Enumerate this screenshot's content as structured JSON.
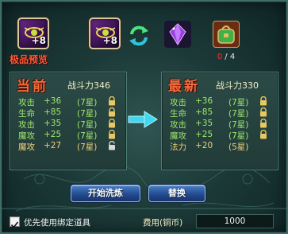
{
  "top": {
    "premium_preview_label": "极品预览",
    "preview_slot_plus": "+8",
    "current_slot_plus": "+8",
    "bag_count_current": "0",
    "bag_count_separator": " / ",
    "bag_count_total": "4"
  },
  "current": {
    "title": "当前",
    "power_label": "战斗力",
    "power_value": "346",
    "rows": [
      {
        "attr": "攻击",
        "value": "+36",
        "star": "(7星)",
        "locked": true
      },
      {
        "attr": "生命",
        "value": "+85",
        "star": "(7星)",
        "locked": true
      },
      {
        "attr": "攻击",
        "value": "+35",
        "star": "(7星)",
        "locked": true
      },
      {
        "attr": "魔攻",
        "value": "+25",
        "star": "(7星)",
        "locked": true
      },
      {
        "attr": "魔攻",
        "value": "+27",
        "star": "(7星)",
        "locked": false
      }
    ]
  },
  "latest": {
    "title": "最新",
    "power_label": "战斗力",
    "power_value": "330",
    "rows": [
      {
        "attr": "攻击",
        "value": "+36",
        "star": "(7星)",
        "locked": true
      },
      {
        "attr": "生命",
        "value": "+85",
        "star": "(7星)",
        "locked": true
      },
      {
        "attr": "攻击",
        "value": "+35",
        "star": "(7星)",
        "locked": true
      },
      {
        "attr": "魔攻",
        "value": "+25",
        "star": "(7星)",
        "locked": true
      },
      {
        "attr": "法力",
        "value": "+20",
        "star": "(5星)",
        "locked": false
      }
    ]
  },
  "actions": {
    "start_refine_label": "开始洗炼",
    "replace_label": "替换"
  },
  "footer": {
    "prefer_bound_label": "优先使用绑定道具",
    "prefer_bound_checked": true,
    "cost_label": "费用(铜币)",
    "cost_value": "1000"
  },
  "icons": {
    "preview_slot": "enhanced-item-icon",
    "current_slot": "enhanced-item-icon",
    "refresh": "refresh-cycle-icon",
    "crystal": "purple-crystal-icon",
    "bag": "green-bag-icon",
    "arrow": "right-arrow-icon",
    "lock": "lock-icon",
    "checkbox": "check-icon"
  },
  "colors": {
    "title_orange": "#f26a3e",
    "attr_green": "#9fe86a",
    "attr_gold": "#f0d078",
    "premium_red": "#ff5a3c",
    "button_blue": "#234c91"
  }
}
